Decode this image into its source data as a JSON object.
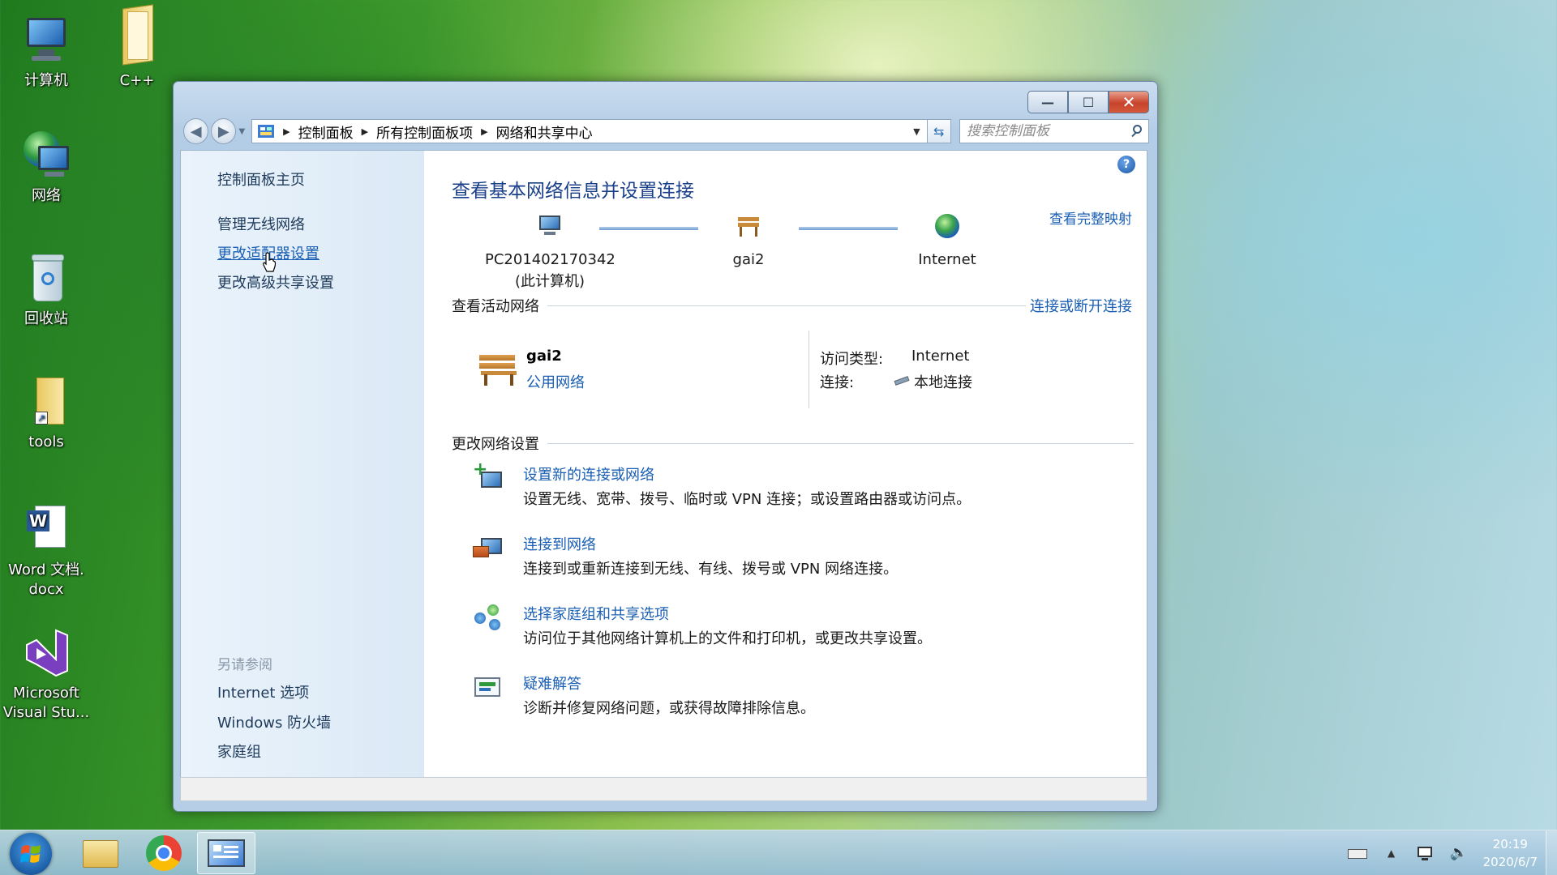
{
  "desktop": {
    "icons": [
      {
        "label": "计算机"
      },
      {
        "label": "C++"
      },
      {
        "label": "网络"
      },
      {
        "label": "回收站"
      },
      {
        "label": "tools"
      },
      {
        "label_line1": "Word 文档.",
        "label_line2": "docx"
      },
      {
        "label_line1": "Microsoft",
        "label_line2": "Visual Stu..."
      }
    ]
  },
  "window": {
    "controls": {
      "minimize": "—",
      "maximize": "☐",
      "close": "✕"
    },
    "address": {
      "crumbs": [
        "控制面板",
        "所有控制面板项",
        "网络和共享中心"
      ],
      "search_placeholder": "搜索控制面板"
    },
    "sidebar": {
      "items": [
        "控制面板主页",
        "管理无线网络",
        "更改适配器设置",
        "更改高级共享设置"
      ],
      "see_also_heading": "另请参阅",
      "see_also": [
        "Internet 选项",
        "Windows 防火墙",
        "家庭组"
      ]
    },
    "main": {
      "help": "?",
      "title": "查看基本网络信息并设置连接",
      "view_full_map": "查看完整映射",
      "nodes": [
        {
          "line1": "PC201402170342",
          "line2": "(此计算机)"
        },
        {
          "line1": "gai2"
        },
        {
          "line1": "Internet"
        }
      ],
      "active_networks_heading": "查看活动网络",
      "connect_disconnect": "连接或断开连接",
      "network": {
        "name": "gai2",
        "type": "公用网络",
        "access_type_label": "访问类型:",
        "access_type_value": "Internet",
        "connection_label": "连接:",
        "connection_value": "本地连接"
      },
      "change_settings_heading": "更改网络设置",
      "tasks": [
        {
          "link": "设置新的连接或网络",
          "desc": "设置无线、宽带、拨号、临时或 VPN 连接；或设置路由器或访问点。",
          "icon": "new-connection-icon"
        },
        {
          "link": "连接到网络",
          "desc": "连接到或重新连接到无线、有线、拨号或 VPN 网络连接。",
          "icon": "connect-network-icon"
        },
        {
          "link": "选择家庭组和共享选项",
          "desc": "访问位于其他网络计算机上的文件和打印机，或更改共享设置。",
          "icon": "homegroup-icon"
        },
        {
          "link": "疑难解答",
          "desc": "诊断并修复网络问题，或获得故障排除信息。",
          "icon": "troubleshoot-icon"
        }
      ]
    }
  },
  "taskbar": {
    "clock_time": "20:19",
    "clock_date": "2020/6/7"
  }
}
